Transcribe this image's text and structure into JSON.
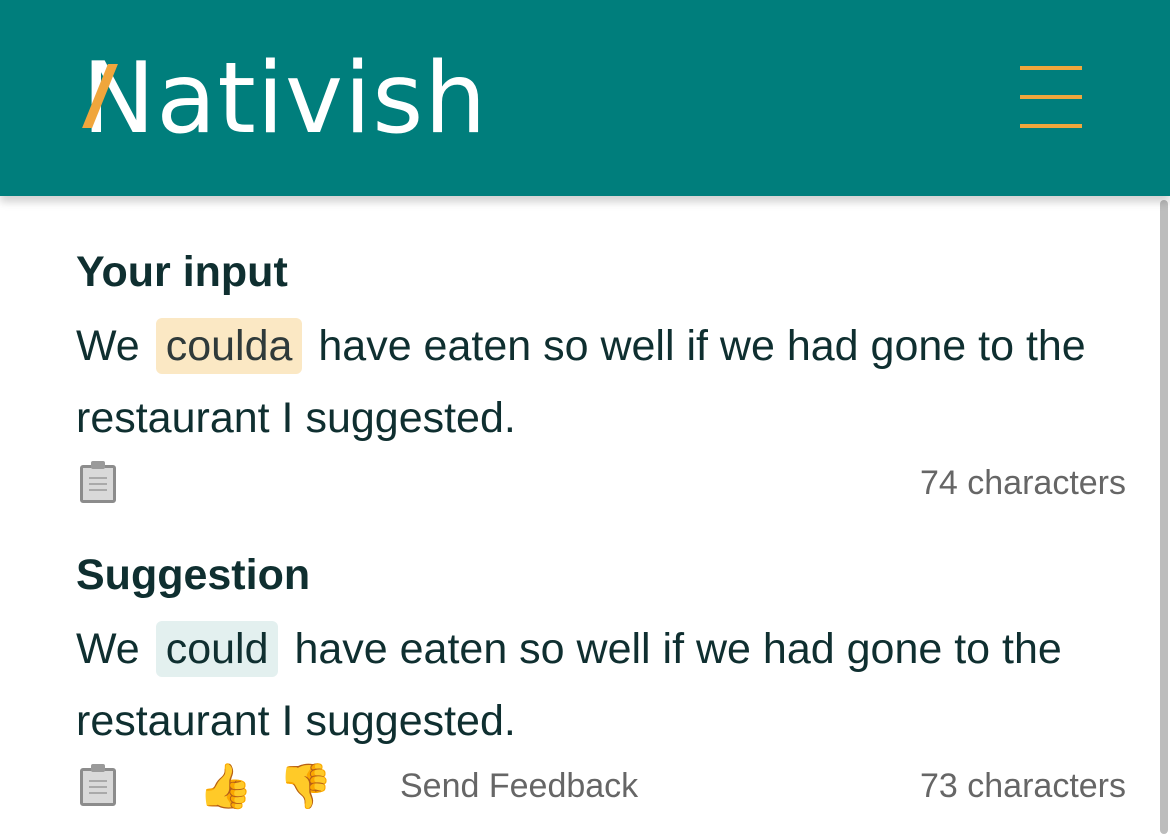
{
  "header": {
    "logo": "Nativish",
    "menu_icon": "hamburger-icon",
    "brand_color": "#007e7c",
    "accent_color": "#f0a63c"
  },
  "input": {
    "title": "Your input",
    "before": "We",
    "highlight": "coulda",
    "after": "have eaten so well if we had gone to the restaurant I suggested.",
    "char_count": "74 characters",
    "copy_icon": "clipboard-icon"
  },
  "suggestion": {
    "title": "Suggestion",
    "before": "We",
    "highlight": "could",
    "after": "have eaten so well if we had gone to the restaurant I suggested.",
    "char_count": "73 characters",
    "copy_icon": "clipboard-icon",
    "thumbs_up_icon": "thumbs-up-icon",
    "thumbs_down_icon": "thumbs-down-icon",
    "feedback_label": "Send Feedback"
  }
}
